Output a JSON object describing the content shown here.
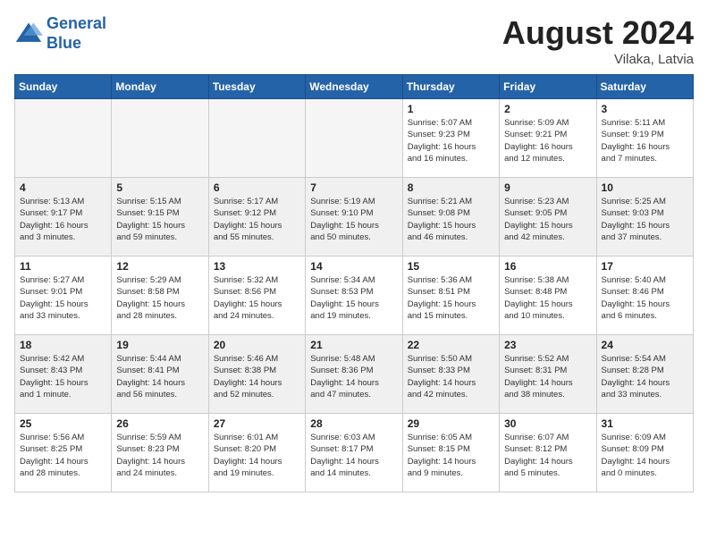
{
  "header": {
    "logo_line1": "General",
    "logo_line2": "Blue",
    "month_title": "August 2024",
    "location": "Vilaka, Latvia"
  },
  "weekdays": [
    "Sunday",
    "Monday",
    "Tuesday",
    "Wednesday",
    "Thursday",
    "Friday",
    "Saturday"
  ],
  "weeks": [
    [
      {
        "day": "",
        "info": "",
        "empty": true
      },
      {
        "day": "",
        "info": "",
        "empty": true
      },
      {
        "day": "",
        "info": "",
        "empty": true
      },
      {
        "day": "",
        "info": "",
        "empty": true
      },
      {
        "day": "1",
        "info": "Sunrise: 5:07 AM\nSunset: 9:23 PM\nDaylight: 16 hours\nand 16 minutes."
      },
      {
        "day": "2",
        "info": "Sunrise: 5:09 AM\nSunset: 9:21 PM\nDaylight: 16 hours\nand 12 minutes."
      },
      {
        "day": "3",
        "info": "Sunrise: 5:11 AM\nSunset: 9:19 PM\nDaylight: 16 hours\nand 7 minutes."
      }
    ],
    [
      {
        "day": "4",
        "info": "Sunrise: 5:13 AM\nSunset: 9:17 PM\nDaylight: 16 hours\nand 3 minutes."
      },
      {
        "day": "5",
        "info": "Sunrise: 5:15 AM\nSunset: 9:15 PM\nDaylight: 15 hours\nand 59 minutes."
      },
      {
        "day": "6",
        "info": "Sunrise: 5:17 AM\nSunset: 9:12 PM\nDaylight: 15 hours\nand 55 minutes."
      },
      {
        "day": "7",
        "info": "Sunrise: 5:19 AM\nSunset: 9:10 PM\nDaylight: 15 hours\nand 50 minutes."
      },
      {
        "day": "8",
        "info": "Sunrise: 5:21 AM\nSunset: 9:08 PM\nDaylight: 15 hours\nand 46 minutes."
      },
      {
        "day": "9",
        "info": "Sunrise: 5:23 AM\nSunset: 9:05 PM\nDaylight: 15 hours\nand 42 minutes."
      },
      {
        "day": "10",
        "info": "Sunrise: 5:25 AM\nSunset: 9:03 PM\nDaylight: 15 hours\nand 37 minutes."
      }
    ],
    [
      {
        "day": "11",
        "info": "Sunrise: 5:27 AM\nSunset: 9:01 PM\nDaylight: 15 hours\nand 33 minutes."
      },
      {
        "day": "12",
        "info": "Sunrise: 5:29 AM\nSunset: 8:58 PM\nDaylight: 15 hours\nand 28 minutes."
      },
      {
        "day": "13",
        "info": "Sunrise: 5:32 AM\nSunset: 8:56 PM\nDaylight: 15 hours\nand 24 minutes."
      },
      {
        "day": "14",
        "info": "Sunrise: 5:34 AM\nSunset: 8:53 PM\nDaylight: 15 hours\nand 19 minutes."
      },
      {
        "day": "15",
        "info": "Sunrise: 5:36 AM\nSunset: 8:51 PM\nDaylight: 15 hours\nand 15 minutes."
      },
      {
        "day": "16",
        "info": "Sunrise: 5:38 AM\nSunset: 8:48 PM\nDaylight: 15 hours\nand 10 minutes."
      },
      {
        "day": "17",
        "info": "Sunrise: 5:40 AM\nSunset: 8:46 PM\nDaylight: 15 hours\nand 6 minutes."
      }
    ],
    [
      {
        "day": "18",
        "info": "Sunrise: 5:42 AM\nSunset: 8:43 PM\nDaylight: 15 hours\nand 1 minute."
      },
      {
        "day": "19",
        "info": "Sunrise: 5:44 AM\nSunset: 8:41 PM\nDaylight: 14 hours\nand 56 minutes."
      },
      {
        "day": "20",
        "info": "Sunrise: 5:46 AM\nSunset: 8:38 PM\nDaylight: 14 hours\nand 52 minutes."
      },
      {
        "day": "21",
        "info": "Sunrise: 5:48 AM\nSunset: 8:36 PM\nDaylight: 14 hours\nand 47 minutes."
      },
      {
        "day": "22",
        "info": "Sunrise: 5:50 AM\nSunset: 8:33 PM\nDaylight: 14 hours\nand 42 minutes."
      },
      {
        "day": "23",
        "info": "Sunrise: 5:52 AM\nSunset: 8:31 PM\nDaylight: 14 hours\nand 38 minutes."
      },
      {
        "day": "24",
        "info": "Sunrise: 5:54 AM\nSunset: 8:28 PM\nDaylight: 14 hours\nand 33 minutes."
      }
    ],
    [
      {
        "day": "25",
        "info": "Sunrise: 5:56 AM\nSunset: 8:25 PM\nDaylight: 14 hours\nand 28 minutes."
      },
      {
        "day": "26",
        "info": "Sunrise: 5:59 AM\nSunset: 8:23 PM\nDaylight: 14 hours\nand 24 minutes."
      },
      {
        "day": "27",
        "info": "Sunrise: 6:01 AM\nSunset: 8:20 PM\nDaylight: 14 hours\nand 19 minutes."
      },
      {
        "day": "28",
        "info": "Sunrise: 6:03 AM\nSunset: 8:17 PM\nDaylight: 14 hours\nand 14 minutes."
      },
      {
        "day": "29",
        "info": "Sunrise: 6:05 AM\nSunset: 8:15 PM\nDaylight: 14 hours\nand 9 minutes."
      },
      {
        "day": "30",
        "info": "Sunrise: 6:07 AM\nSunset: 8:12 PM\nDaylight: 14 hours\nand 5 minutes."
      },
      {
        "day": "31",
        "info": "Sunrise: 6:09 AM\nSunset: 8:09 PM\nDaylight: 14 hours\nand 0 minutes."
      }
    ]
  ]
}
